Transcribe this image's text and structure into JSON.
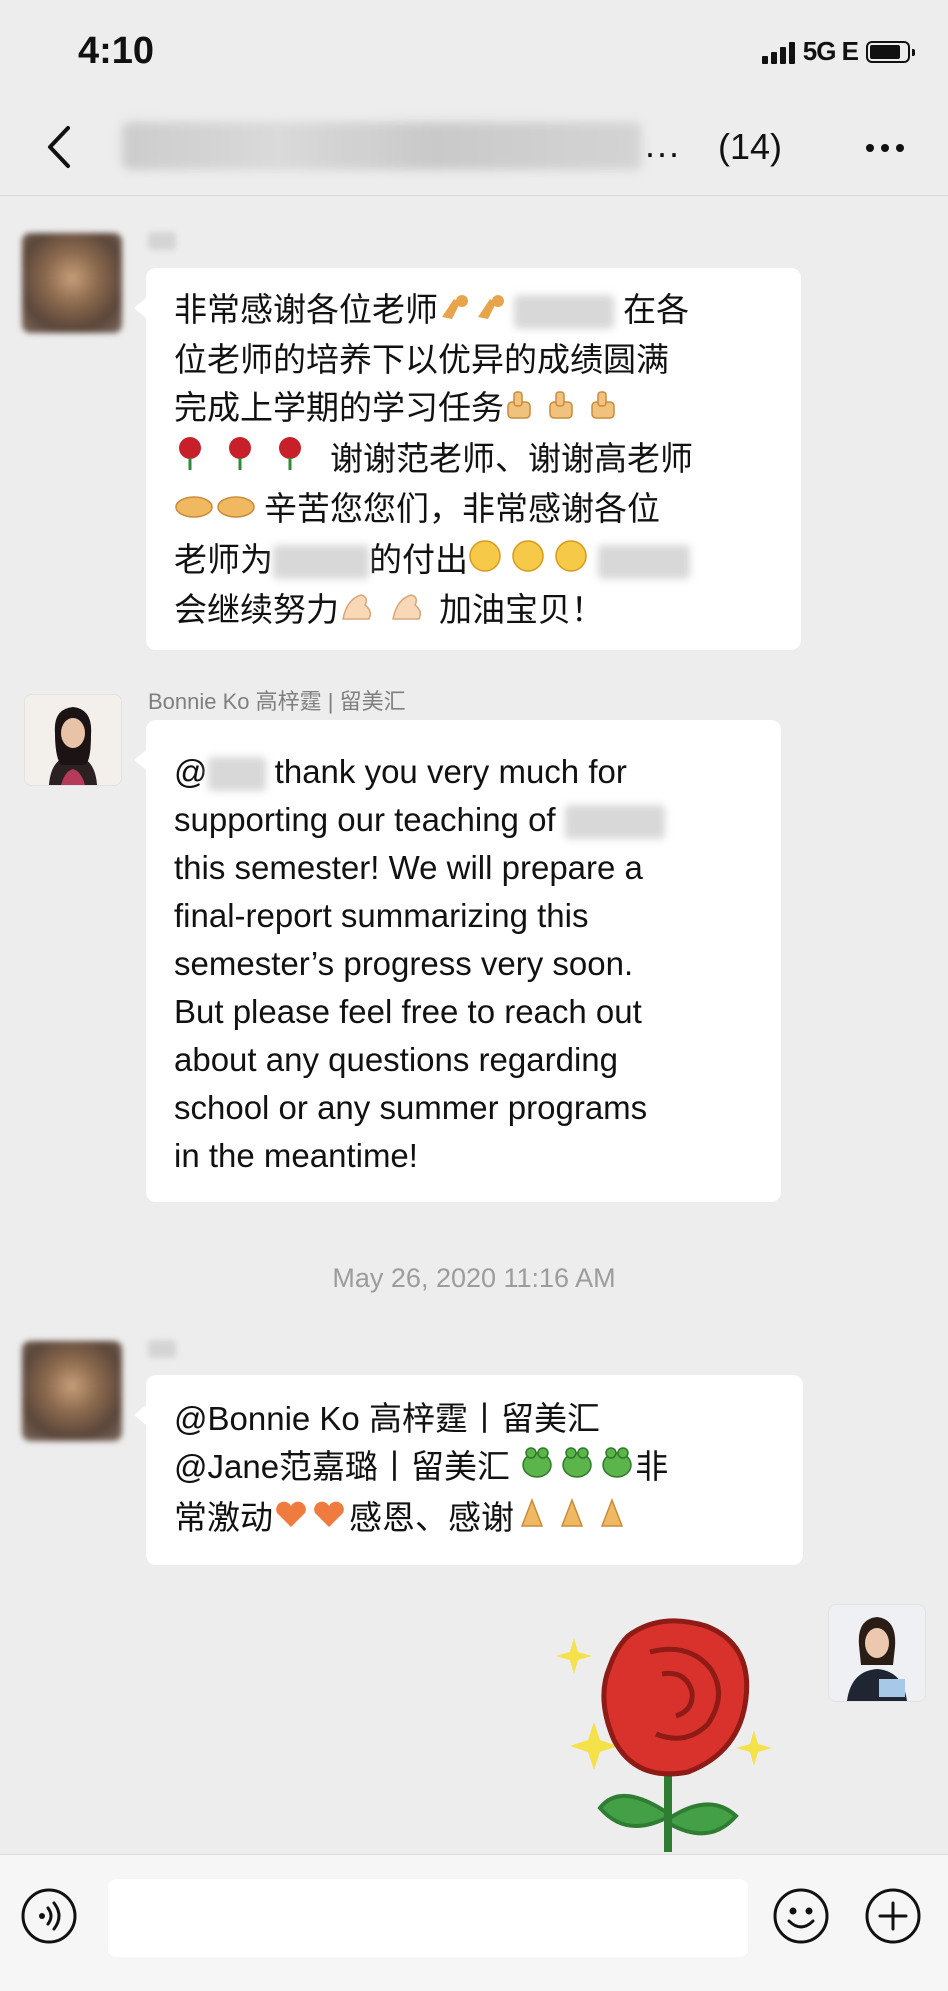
{
  "status_bar": {
    "time": "4:10",
    "network": "5G E"
  },
  "nav": {
    "count": "(14)",
    "ellipsis": "..."
  },
  "messages": {
    "m1": {
      "line1_a": "非常感谢各位老师",
      "line1_b": "在各",
      "line2": "位老师的培养下以优异的成绩圆满",
      "line3": "完成上学期的学习任务",
      "line4": "谢谢范老师、谢谢高老师",
      "line5": "辛苦您您们，非常感谢各位",
      "line6_a": "老师为",
      "line6_b": "的付出",
      "line7_a": "会继续努力",
      "line7_b": "加油宝贝！"
    },
    "m2": {
      "sender": "Bonnie Ko 高梓霆 | 留美汇",
      "line1_a": "@",
      "line1_b": " thank you very much for",
      "line2": "supporting our teaching of",
      "line3": "this semester! We will prepare a",
      "line4": "final-report summarizing this",
      "line5": "semester’s progress very soon.",
      "line6": "But please feel free to reach out",
      "line7": "about any questions regarding",
      "line8": "school or any summer programs",
      "line9": "in the meantime!"
    },
    "timestamp": "May 26, 2020 11:16 AM",
    "m3": {
      "line1": "@Bonnie Ko 高梓霆丨留美汇",
      "line2_a": "@Jane范嘉璐丨留美汇",
      "line2_b": "非",
      "line3_a": "常激动",
      "line3_b": "感恩、感谢"
    },
    "m4": {
      "sticker": "rose-sticker"
    }
  },
  "icons": {
    "back": "chevron-left-icon",
    "more": "more-dots-icon",
    "voice": "voice-icon",
    "emoji": "emoji-icon",
    "add": "plus-icon"
  },
  "colors": {
    "background": "#ededed",
    "bubble": "#ffffff",
    "rose": "#d9312b",
    "leaf": "#3a9a3a",
    "sparkle": "#f5e14a"
  }
}
